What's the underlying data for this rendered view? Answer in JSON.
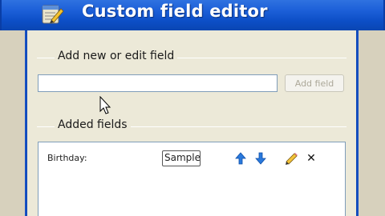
{
  "window": {
    "title": "Custom field editor",
    "icon": "notepad-pencil-icon"
  },
  "new_field_group": {
    "legend": "Add new or edit field",
    "input_value": "",
    "add_button_label": "Add field"
  },
  "added_fields_group": {
    "legend": "Added fields",
    "fields": [
      {
        "name": "Birthday:",
        "sample_text": "Sample",
        "actions": [
          "move-up-icon",
          "move-down-icon",
          "edit-pencil-icon",
          "delete-icon"
        ],
        "delete_glyph": "✕"
      }
    ]
  },
  "colors": {
    "titlebar": "#0c4ec6",
    "dialog_bg": "#ece9d8",
    "arrow_blue": "#1f6fd6"
  }
}
